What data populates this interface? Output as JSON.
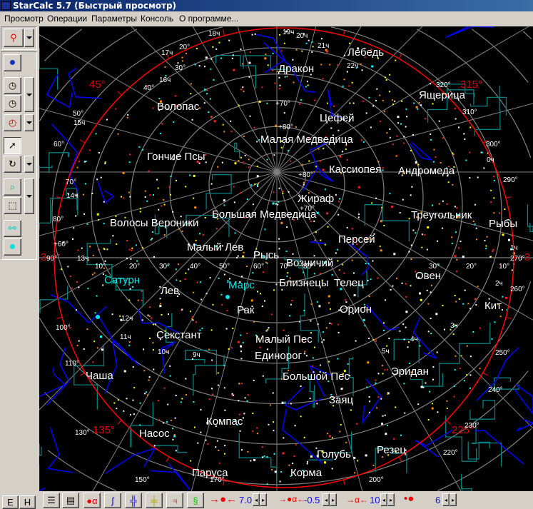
{
  "window": {
    "title": "StarCalc 5.7 (Быстрый просмотр)"
  },
  "menu": [
    "Просмотр",
    "Операции",
    "Параметры",
    "Консоль",
    "О программе..."
  ],
  "constellations": [
    "Лебедь",
    "Дракон",
    "Ящерица",
    "Волопас",
    "Цефей",
    "Малая Медведица",
    "Гончие Псы",
    "Кассиопея",
    "Андромеда",
    "Жираф",
    "Большая Медведица",
    "Треугольник",
    "Волосы Вероники",
    "Рыбы",
    "Персей",
    "Малый Лев",
    "Рысь",
    "Возничий",
    "Овен",
    "Лев",
    "Близнецы",
    "Телец",
    "Кит",
    "Рак",
    "Орион",
    "Секстант",
    "Малый Пес",
    "Единорог",
    "Эридан",
    "Чаша",
    "Большой Пес",
    "Заяц",
    "Компас",
    "Насос",
    "Резец",
    "Голубь",
    "Паруса",
    "Корма"
  ],
  "planets": [
    "Сатурн",
    "Марс"
  ],
  "azimuth_labels": [
    "45°",
    "315°",
    "135°",
    "225°",
    "3",
    "3"
  ],
  "grid_labels": [
    "18ч",
    "19ч",
    "20°",
    "17ч",
    "20ч",
    "21ч",
    "30°",
    "16ч",
    "40°",
    "22ч",
    "320°",
    "50°",
    "15ч",
    "310°",
    "60°",
    "300°",
    "0ч",
    "70°",
    "290°",
    "14ч",
    "80°",
    "90°",
    "13ч",
    "270°",
    "10°",
    "20°",
    "30°",
    "40°",
    "50°",
    "60°",
    "70°",
    "80°",
    "30°",
    "20°",
    "10°",
    "1ч",
    "2ч",
    "260°",
    "12ч",
    "100°",
    "11ч",
    "10ч",
    "9ч",
    "3ч",
    "4ч",
    "5ч",
    "250°",
    "110°",
    "240°",
    "230°",
    "130°",
    "220°",
    "150°",
    "170°",
    "200°",
    "+70°",
    "+80°",
    "+80°",
    "+70°",
    "+60°"
  ],
  "bottom_toolbar": {
    "star_magnitude": "7.0",
    "deepsky_magnitude": "-0.5",
    "label_magnitude": "10",
    "star_size": "6",
    "hemisphere_e": "E",
    "hemisphere_h": "H"
  },
  "colors": {
    "map_bg": "#000000",
    "horizon": "#ff0000",
    "grid": "#808080",
    "boundaries": "#008080",
    "figures": "#0000ff",
    "planet": "#00e5e5"
  }
}
